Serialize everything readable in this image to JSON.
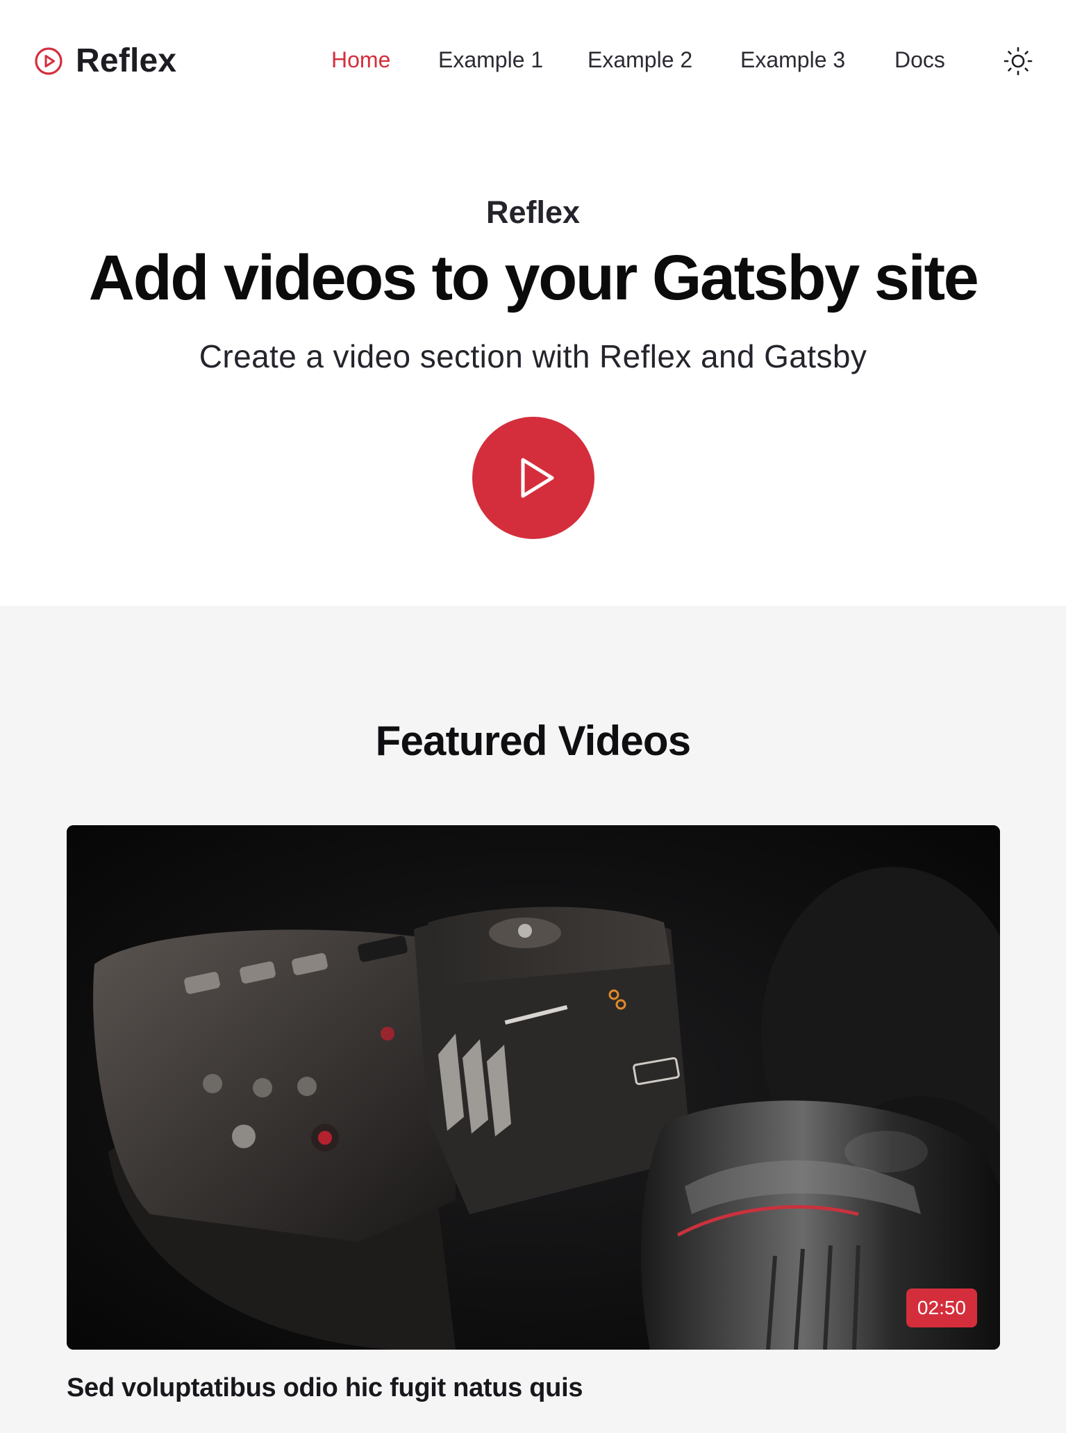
{
  "brand": {
    "name": "Reflex",
    "accent_color": "#d42e3c",
    "logo_icon": "play-circle-icon"
  },
  "nav": {
    "items": [
      {
        "label": "Home",
        "active": true
      },
      {
        "label": "Example 1",
        "active": false
      },
      {
        "label": "Example 2",
        "active": false
      },
      {
        "label": "Example 3",
        "active": false
      },
      {
        "label": "Docs",
        "active": false
      }
    ],
    "theme_toggle_icon": "sun-icon"
  },
  "hero": {
    "eyebrow": "Reflex",
    "title": "Add videos to your Gatsby site",
    "subtitle": "Create a video section with Reflex and Gatsby",
    "play_icon": "play-icon"
  },
  "featured": {
    "heading": "Featured Videos",
    "videos": [
      {
        "title": "Sed voluptatibus odio hic fugit natus quis",
        "duration": "02:50",
        "thumbnail": "camera-photo"
      }
    ]
  }
}
